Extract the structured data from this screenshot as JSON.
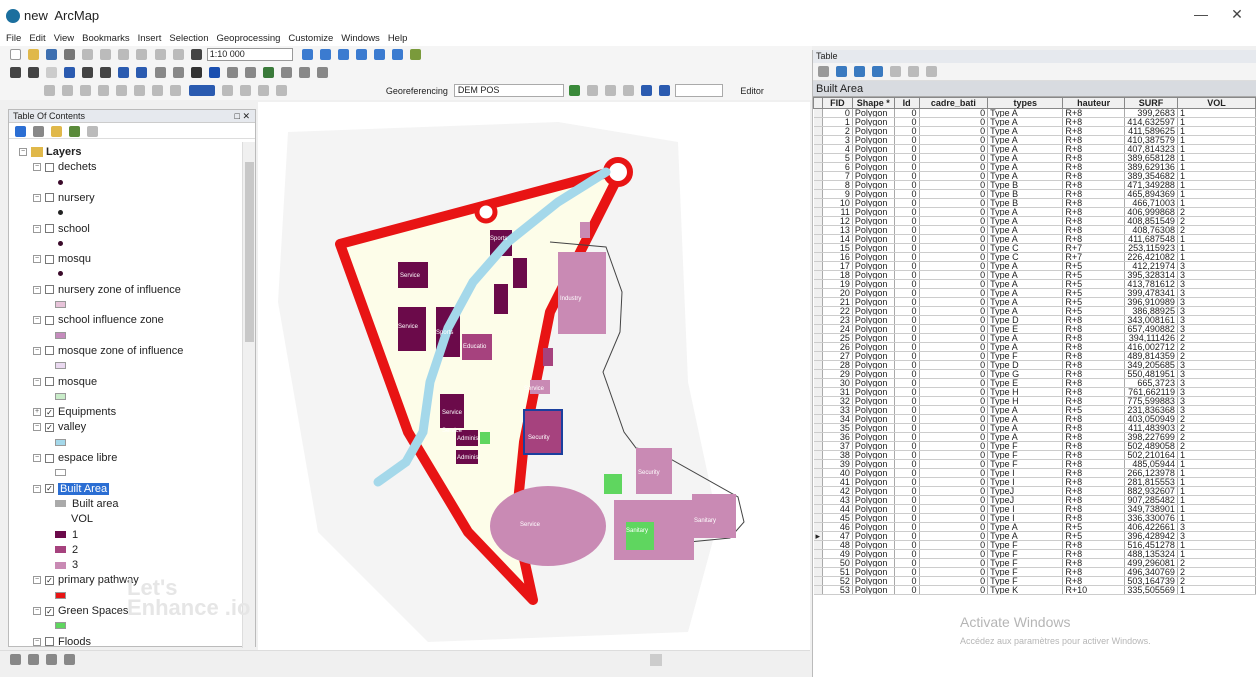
{
  "app": {
    "title": "new - ArcMap",
    "title_short": "new",
    "title_app": "ArcMap"
  },
  "menu": [
    "File",
    "Edit",
    "View",
    "Bookmarks",
    "Insert",
    "Selection",
    "Geoprocessing",
    "Customize",
    "Windows",
    "Help"
  ],
  "toolbar": {
    "scale": "1:10 000",
    "georef_label": "Georeferencing",
    "georef_layer": "DEM POS",
    "editor_label": "Editor"
  },
  "toc": {
    "title": "Table Of Contents",
    "root": "Layers",
    "items": [
      {
        "label": "dechets",
        "checked": false,
        "swatch": "dot",
        "color": "#3a0a2a"
      },
      {
        "label": "nursery",
        "checked": false,
        "swatch": "dot",
        "color": "#222222"
      },
      {
        "label": "school",
        "checked": false,
        "swatch": "dot",
        "color": "#3a0a2a"
      },
      {
        "label": "mosqu",
        "checked": false,
        "swatch": "dot",
        "color": "#3a0a2a"
      },
      {
        "label": "nursery zone of influence",
        "checked": false,
        "swatch": "rect",
        "color": "#e7c3d9"
      },
      {
        "label": "school influence zone",
        "checked": false,
        "swatch": "rect",
        "color": "#c58bbd"
      },
      {
        "label": "mosque zone of influence",
        "checked": false,
        "swatch": "rect",
        "color": "#ead9f0"
      },
      {
        "label": "mosque",
        "checked": false,
        "swatch": "rect",
        "color": "#c9ecc9"
      },
      {
        "label": "Equipments",
        "checked": true,
        "swatch": "none",
        "color": ""
      },
      {
        "label": "valley",
        "checked": true,
        "swatch": "rect",
        "color": "#a4d8ea"
      },
      {
        "label": "espace libre",
        "checked": false,
        "swatch": "rect",
        "color": "#ffffff"
      },
      {
        "label": "Built Area",
        "checked": true,
        "swatch": "none",
        "color": "",
        "selected": true
      },
      {
        "label": "primary pathway",
        "checked": true,
        "swatch": "rect",
        "color": "#e81414"
      },
      {
        "label": "Green Spaces",
        "checked": true,
        "swatch": "rect",
        "color": "#5fd65f"
      },
      {
        "label": "Floods",
        "checked": false,
        "swatch": "rect",
        "color": "#b6dff0"
      }
    ],
    "built_area_legend": {
      "heading": "Built area",
      "field": "VOL",
      "classes": [
        {
          "label": "1",
          "color": "#6b0a4a"
        },
        {
          "label": "2",
          "color": "#a6427e"
        },
        {
          "label": "3",
          "color": "#c98ab4"
        }
      ]
    }
  },
  "watermark": "Let's Enhance .io",
  "map_labels": [
    "Sports",
    "Service",
    "Service",
    "Sports",
    "Industry",
    "Educatio",
    "Service",
    "Service",
    "Service",
    "Administ",
    "Administ",
    "Security",
    "Security",
    "Service",
    "Sanitary",
    "Sanitary"
  ],
  "table": {
    "window_title": "Table",
    "tab": "Built Area",
    "columns": [
      "FID",
      "Shape *",
      "Id",
      "cadre_bati",
      "types",
      "hauteur",
      "SURF",
      "VOL"
    ],
    "rows": [
      [
        "0",
        "Polygon",
        "0",
        "0",
        "Type A",
        "R+8",
        "399,2683",
        "1"
      ],
      [
        "1",
        "Polygon",
        "0",
        "0",
        "Type A",
        "R+8",
        "414,632597",
        "1"
      ],
      [
        "2",
        "Polygon",
        "0",
        "0",
        "Type A",
        "R+8",
        "411,589625",
        "1"
      ],
      [
        "3",
        "Polygon",
        "0",
        "0",
        "Type A",
        "R+8",
        "410,387579",
        "1"
      ],
      [
        "4",
        "Polygon",
        "0",
        "0",
        "Type A",
        "R+8",
        "407,814323",
        "1"
      ],
      [
        "5",
        "Polygon",
        "0",
        "0",
        "Type A",
        "R+8",
        "389,658128",
        "1"
      ],
      [
        "6",
        "Polygon",
        "0",
        "0",
        "Type A",
        "R+8",
        "389,629136",
        "1"
      ],
      [
        "7",
        "Polygon",
        "0",
        "0",
        "Type A",
        "R+8",
        "389,354682",
        "1"
      ],
      [
        "8",
        "Polygon",
        "0",
        "0",
        "Type B",
        "R+8",
        "471,349288",
        "1"
      ],
      [
        "9",
        "Polygon",
        "0",
        "0",
        "Type B",
        "R+8",
        "465,894369",
        "1"
      ],
      [
        "10",
        "Polygon",
        "0",
        "0",
        "Type B",
        "R+8",
        "466,71003",
        "1"
      ],
      [
        "11",
        "Polygon",
        "0",
        "0",
        "Type A",
        "R+8",
        "406,999868",
        "2"
      ],
      [
        "12",
        "Polygon",
        "0",
        "0",
        "Type A",
        "R+8",
        "408,851549",
        "2"
      ],
      [
        "13",
        "Polygon",
        "0",
        "0",
        "Type A",
        "R+8",
        "408,76308",
        "2"
      ],
      [
        "14",
        "Polygon",
        "0",
        "0",
        "Type A",
        "R+8",
        "411,687548",
        "1"
      ],
      [
        "15",
        "Polygon",
        "0",
        "0",
        "Type C",
        "R+7",
        "253,115923",
        "1"
      ],
      [
        "16",
        "Polygon",
        "0",
        "0",
        "Type C",
        "R+7",
        "226,421082",
        "1"
      ],
      [
        "17",
        "Polygon",
        "0",
        "0",
        "Type A",
        "R+5",
        "412,21974",
        "3"
      ],
      [
        "18",
        "Polygon",
        "0",
        "0",
        "Type A",
        "R+5",
        "395,328314",
        "3"
      ],
      [
        "19",
        "Polygon",
        "0",
        "0",
        "Type A",
        "R+5",
        "413,781612",
        "3"
      ],
      [
        "20",
        "Polygon",
        "0",
        "0",
        "Type A",
        "R+5",
        "399,478341",
        "3"
      ],
      [
        "21",
        "Polygon",
        "0",
        "0",
        "Type A",
        "R+5",
        "396,910989",
        "3"
      ],
      [
        "22",
        "Polygon",
        "0",
        "0",
        "Type A",
        "R+5",
        "386,88925",
        "3"
      ],
      [
        "23",
        "Polygon",
        "0",
        "0",
        "Type D",
        "R+8",
        "343,008161",
        "3"
      ],
      [
        "24",
        "Polygon",
        "0",
        "0",
        "Type E",
        "R+8",
        "657,490882",
        "3"
      ],
      [
        "25",
        "Polygon",
        "0",
        "0",
        "Type A",
        "R+8",
        "394,111426",
        "2"
      ],
      [
        "26",
        "Polygon",
        "0",
        "0",
        "Type A",
        "R+8",
        "416,002712",
        "2"
      ],
      [
        "27",
        "Polygon",
        "0",
        "0",
        "Type F",
        "R+8",
        "489,814359",
        "2"
      ],
      [
        "28",
        "Polygon",
        "0",
        "0",
        "Type D",
        "R+8",
        "349,205685",
        "3"
      ],
      [
        "29",
        "Polygon",
        "0",
        "0",
        "Type G",
        "R+8",
        "550,481951",
        "3"
      ],
      [
        "30",
        "Polygon",
        "0",
        "0",
        "Type E",
        "R+8",
        "665,3723",
        "3"
      ],
      [
        "31",
        "Polygon",
        "0",
        "0",
        "Type H",
        "R+8",
        "761,662119",
        "3"
      ],
      [
        "32",
        "Polygon",
        "0",
        "0",
        "Type H",
        "R+8",
        "775,599883",
        "3"
      ],
      [
        "33",
        "Polygon",
        "0",
        "0",
        "Type A",
        "R+5",
        "231,836368",
        "3"
      ],
      [
        "34",
        "Polygon",
        "0",
        "0",
        "Type A",
        "R+8",
        "403,050949",
        "2"
      ],
      [
        "35",
        "Polygon",
        "0",
        "0",
        "Type A",
        "R+8",
        "411,483903",
        "2"
      ],
      [
        "36",
        "Polygon",
        "0",
        "0",
        "Type A",
        "R+8",
        "398,227699",
        "2"
      ],
      [
        "37",
        "Polygon",
        "0",
        "0",
        "Type F",
        "R+8",
        "502,489058",
        "2"
      ],
      [
        "38",
        "Polygon",
        "0",
        "0",
        "Type F",
        "R+8",
        "502,210164",
        "1"
      ],
      [
        "39",
        "Polygon",
        "0",
        "0",
        "Type F",
        "R+8",
        "485,05944",
        "1"
      ],
      [
        "40",
        "Polygon",
        "0",
        "0",
        "Type I",
        "R+8",
        "266,123978",
        "1"
      ],
      [
        "41",
        "Polygon",
        "0",
        "0",
        "Type I",
        "R+8",
        "281,815553",
        "1"
      ],
      [
        "42",
        "Polygon",
        "0",
        "0",
        "TypeJ",
        "R+8",
        "882,932607",
        "1"
      ],
      [
        "43",
        "Polygon",
        "0",
        "0",
        "TypeJ",
        "R+8",
        "907,285482",
        "1"
      ],
      [
        "44",
        "Polygon",
        "0",
        "0",
        "Type I",
        "R+8",
        "349,738901",
        "1"
      ],
      [
        "45",
        "Polygon",
        "0",
        "0",
        "Type I",
        "R+8",
        "336,330076",
        "1"
      ],
      [
        "46",
        "Polygon",
        "0",
        "0",
        "Type A",
        "R+5",
        "406,422661",
        "3"
      ],
      [
        "47",
        "Polygon",
        "0",
        "0",
        "Type A",
        "R+5",
        "396,428942",
        "3"
      ],
      [
        "48",
        "Polygon",
        "0",
        "0",
        "Type F",
        "R+8",
        "516,451278",
        "1"
      ],
      [
        "49",
        "Polygon",
        "0",
        "0",
        "Type F",
        "R+8",
        "488,135324",
        "1"
      ],
      [
        "50",
        "Polygon",
        "0",
        "0",
        "Type F",
        "R+8",
        "499,296081",
        "2"
      ],
      [
        "51",
        "Polygon",
        "0",
        "0",
        "Type F",
        "R+8",
        "496,340769",
        "2"
      ],
      [
        "52",
        "Polygon",
        "0",
        "0",
        "Type F",
        "R+8",
        "503,164739",
        "2"
      ],
      [
        "53",
        "Polygon",
        "0",
        "0",
        "Type K",
        "R+10",
        "335,505569",
        "1"
      ]
    ],
    "current_row": 47
  },
  "os_watermark": {
    "line1": "Activate Windows",
    "line2": "Accédez aux paramètres pour activer Windows."
  }
}
